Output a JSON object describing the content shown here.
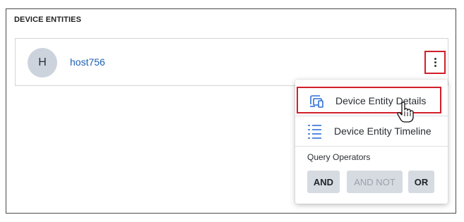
{
  "panel": {
    "title": "DEVICE ENTITIES"
  },
  "entity": {
    "avatar_initial": "H",
    "name": "host756"
  },
  "menu": {
    "items": [
      {
        "label": "Device Entity Details",
        "icon": "device-details-icon"
      },
      {
        "label": "Device Entity Timeline",
        "icon": "timeline-list-icon"
      }
    ],
    "section_label": "Query Operators",
    "operators": [
      {
        "label": "AND",
        "enabled": true
      },
      {
        "label": "AND NOT",
        "enabled": false
      },
      {
        "label": "OR",
        "enabled": true
      }
    ]
  },
  "colors": {
    "link": "#1d60b5",
    "highlight_border": "#d11f2a",
    "avatar_bg": "#ccd3dd",
    "icon_blue": "#2f6fd6",
    "operator_bg": "#d6dbe2"
  }
}
